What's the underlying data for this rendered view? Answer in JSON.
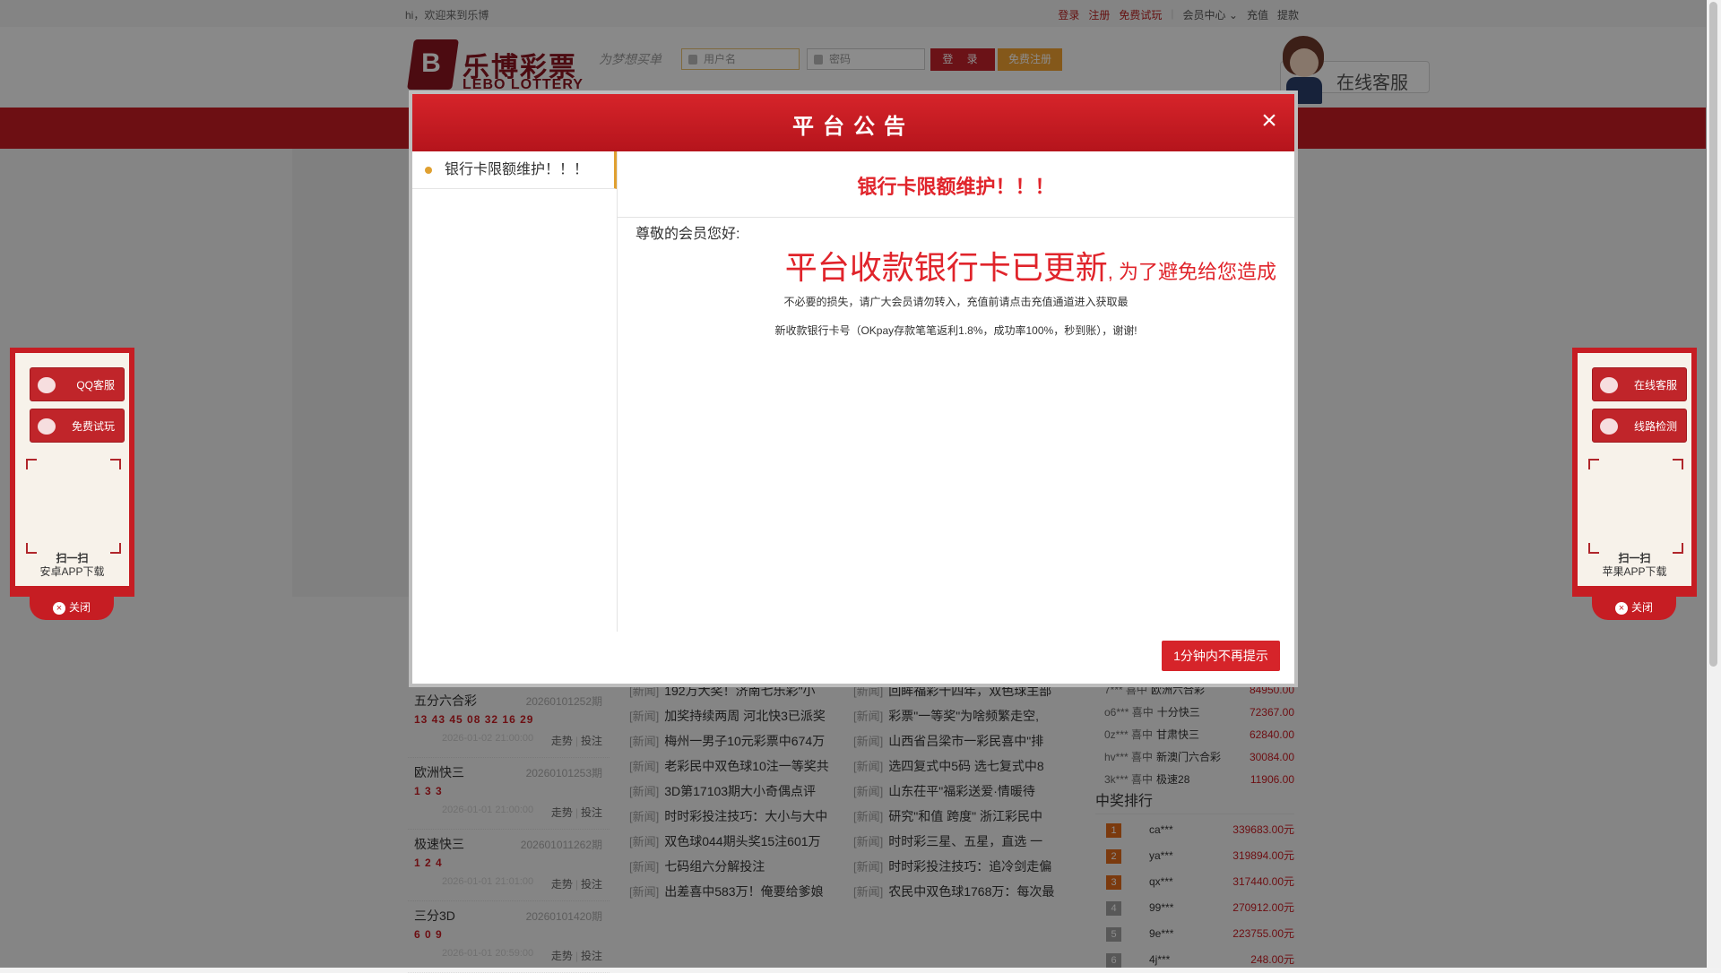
{
  "topbar": {
    "greeting": "hi，欢迎来到乐博",
    "links": [
      "登录",
      "注册",
      "免费试玩"
    ],
    "member_center": "会员中心",
    "recharge": "充值",
    "withdraw": "提款"
  },
  "header": {
    "logo_mark": "B",
    "logo_cn": "乐博彩票",
    "logo_en": "LEBO LOTTERY",
    "slogan": "为梦想买单",
    "username_placeholder": "用户名",
    "password_placeholder": "密码",
    "login_button": "登 录",
    "register_button": "免费注册",
    "customer_service": "在线客服"
  },
  "left_panel": {
    "buttons": [
      "QQ客服",
      "免费试玩"
    ],
    "scan_title": "扫一扫",
    "scan_sub": "安卓APP下载",
    "close": "关闭"
  },
  "right_panel": {
    "buttons": [
      "在线客服",
      "线路检测"
    ],
    "scan_title": "扫一扫",
    "scan_sub": "苹果APP下载",
    "close": "关闭"
  },
  "lotteries": [
    {
      "name": "五分六合彩",
      "issue": "20260101252期",
      "numbers": "13 43 45 08 32 16 29",
      "time": "2026-01-02 21:00:00",
      "trend": "走势",
      "bet": "投注"
    },
    {
      "name": "欧洲快三",
      "issue": "20260101253期",
      "numbers": "1 3 3",
      "time": "2026-01-01 21:00:00",
      "trend": "走势",
      "bet": "投注"
    },
    {
      "name": "极速快三",
      "issue": "202601011262期",
      "numbers": "1 2 4",
      "time": "2026-01-01 21:01:00",
      "trend": "走势",
      "bet": "投注"
    },
    {
      "name": "三分3D",
      "issue": "20260101420期",
      "numbers": "6 0 9",
      "time": "2026-01-01 20:59:00",
      "trend": "走势",
      "bet": "投注"
    }
  ],
  "news_tag": "[新闻]",
  "news_left": [
    "192万大奖！济南七乐彩\"小",
    "加奖持续两周 河北快3已派奖",
    "梅州一男子10元彩票中674万",
    "老彩民中双色球10注一等奖共",
    "3D第17103期大小奇偶点评",
    "时时彩投注技巧：大小与大中",
    "双色球044期头奖15注601万",
    "七码组六分解投注",
    "出差喜中583万！俺要给爹娘"
  ],
  "news_right": [
    "回眸福彩十四年，双色球主部",
    "彩票\"一等奖\"为啥频繁走空,",
    "山西省吕梁市一彩民喜中\"排",
    "选四复式中5码 选七复式中8",
    "山东茌平\"福彩送爱·情暖待",
    "研究\"和值 跨度\" 浙江彩民中",
    "时时彩三星、五星，直选 一",
    "时时彩投注技巧：追冷剑走偏",
    "农民中双色球1768万：每次最"
  ],
  "winners": [
    {
      "user": "7***",
      "word": "喜中",
      "game": "欧洲六合彩",
      "amount": "84950.00"
    },
    {
      "user": "o6***",
      "word": "喜中",
      "game": "十分快三",
      "amount": "72367.00"
    },
    {
      "user": "0z***",
      "word": "喜中",
      "game": "甘肃快三",
      "amount": "62840.00"
    },
    {
      "user": "hv***",
      "word": "喜中",
      "game": "新澳门六合彩",
      "amount": "30084.00"
    },
    {
      "user": "3k***",
      "word": "喜中",
      "game": "极速28",
      "amount": "11906.00"
    }
  ],
  "ranking": {
    "title": "中奖排行",
    "rows": [
      {
        "no": "1",
        "name": "ca***",
        "amount": "339683.00元"
      },
      {
        "no": "2",
        "name": "ya***",
        "amount": "319894.00元"
      },
      {
        "no": "3",
        "name": "qx***",
        "amount": "317440.00元"
      },
      {
        "no": "4",
        "name": "99***",
        "amount": "270912.00元"
      },
      {
        "no": "5",
        "name": "9e***",
        "amount": "223755.00元"
      },
      {
        "no": "6",
        "name": "4j***",
        "amount": "248.00元"
      }
    ]
  },
  "modal": {
    "title": "平台公告",
    "close": "×",
    "side_items": [
      "银行卡限额维护！！！"
    ],
    "notice_title": "银行卡限额维护！！！",
    "greeting": "尊敬的会员您好:",
    "part1": "平台收款银行卡已更新",
    "part2": ", 为了避免给您造成",
    "part3": "不必要的损失，请广大会员请勿转入，",
    "part4": "充值前请点击充值通道进入获取最",
    "part5": "新收款银行卡号",
    "part6": "（OKpay存款笔笔返利1.8%，成功率100%，秒到账），谢谢!",
    "mute_button": "1分钟内不再提示"
  }
}
